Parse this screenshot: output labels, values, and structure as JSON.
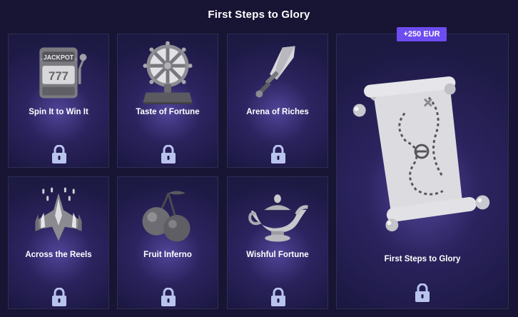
{
  "page": {
    "title": "First Steps to Glory"
  },
  "cards": [
    {
      "label": "Spin It to Win It",
      "icon": "slot-machine-icon",
      "locked": true
    },
    {
      "label": "Taste of Fortune",
      "icon": "wheel-of-fortune-icon",
      "locked": true
    },
    {
      "label": "Arena of Riches",
      "icon": "sword-icon",
      "locked": true
    },
    {
      "label": "Across the Reels",
      "icon": "spaceship-icon",
      "locked": true
    },
    {
      "label": "Fruit Inferno",
      "icon": "cherries-icon",
      "locked": true
    },
    {
      "label": "Wishful Fortune",
      "icon": "magic-lamp-icon",
      "locked": true
    }
  ],
  "feature": {
    "label": "First Steps to Glory",
    "badge": "+250 EUR",
    "icon": "treasure-map-scroll-icon",
    "locked": true
  },
  "slot_art_text": {
    "top": "JACKPOT",
    "reels": "777"
  },
  "colors": {
    "accent": "#6d4cf0",
    "lock": "#b9c4ee",
    "background": "#181433"
  }
}
